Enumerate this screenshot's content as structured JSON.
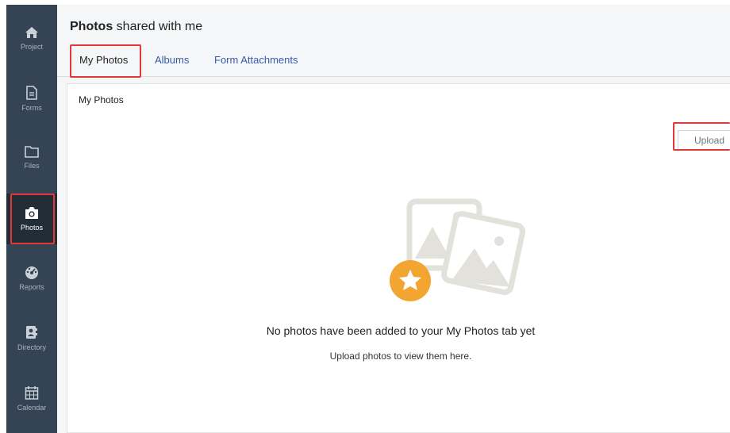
{
  "header": {
    "title_bold": "Photos",
    "title_rest": " shared with me"
  },
  "tabs": [
    {
      "label": "My Photos",
      "active": true
    },
    {
      "label": "Albums",
      "active": false
    },
    {
      "label": "Form Attachments",
      "active": false
    }
  ],
  "sidebar": {
    "items": [
      {
        "label": "Project",
        "icon": "home-icon"
      },
      {
        "label": "Forms",
        "icon": "document-icon"
      },
      {
        "label": "Files",
        "icon": "folder-icon"
      },
      {
        "label": "Photos",
        "icon": "camera-icon",
        "active": true
      },
      {
        "label": "Reports",
        "icon": "gauge-icon"
      },
      {
        "label": "Directory",
        "icon": "contact-book-icon"
      },
      {
        "label": "Calendar",
        "icon": "calendar-icon"
      }
    ]
  },
  "card": {
    "title": "My Photos",
    "upload_label": "Upload",
    "empty_heading": "No photos have been added to your My Photos tab yet",
    "empty_sub": "Upload photos to view them here."
  },
  "colors": {
    "sidebar": "#344455",
    "sidebar_active": "#222d38",
    "highlight": "#e23838",
    "tab_link": "#3a5aa8",
    "star_badge": "#f2a531"
  }
}
